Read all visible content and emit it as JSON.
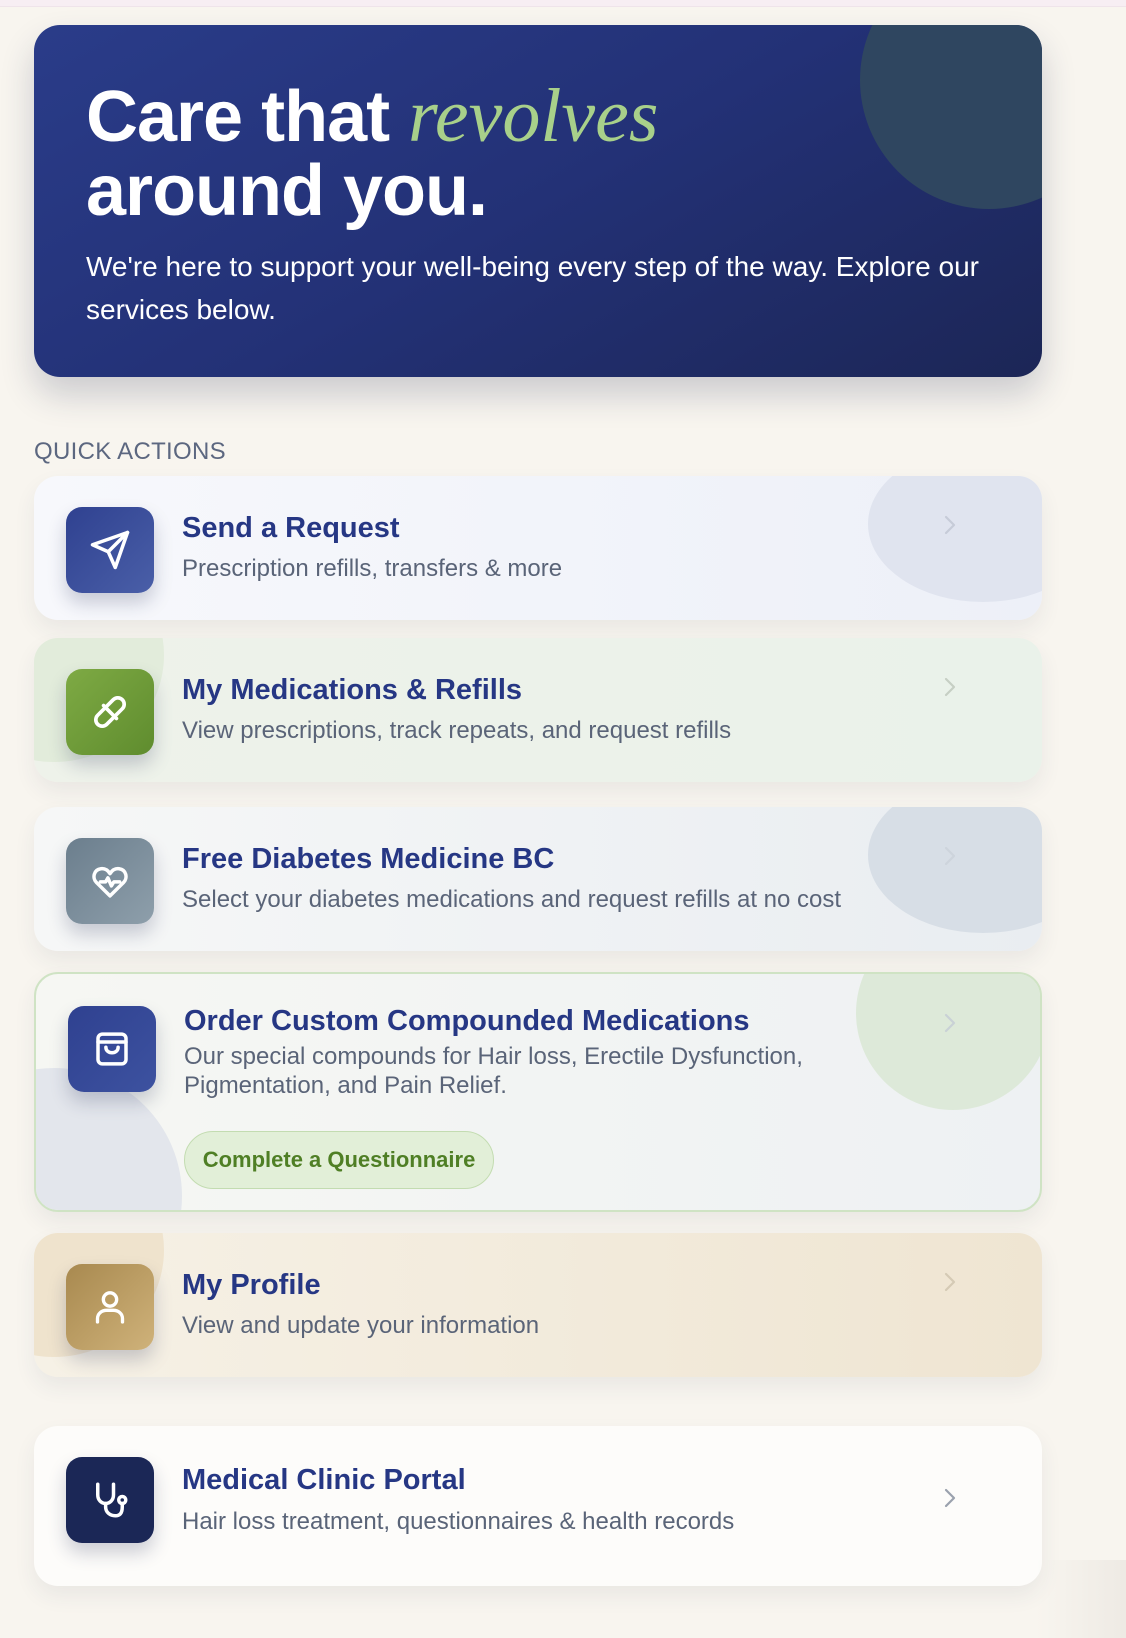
{
  "hero": {
    "title_part1": "Care that ",
    "title_accent": "revolves",
    "title_line2": "around you.",
    "subtitle": "We're here to support your well-being every step of the way. Explore our services below."
  },
  "quick_actions": {
    "label": "QUICK ACTIONS",
    "cards": [
      {
        "title": "Send a Request",
        "description": "Prescription refills, transfers & more",
        "icon": "send-icon"
      },
      {
        "title": "My Medications & Refills",
        "description": "View prescriptions, track repeats, and request refills",
        "icon": "pill-icon"
      },
      {
        "title": "Free Diabetes Medicine BC",
        "description": "Select your diabetes medications and request refills at no cost",
        "icon": "heart-pulse-icon"
      },
      {
        "title": "Order Custom Compounded Medications",
        "description": "Our special compounds for Hair loss, Erectile Dysfunction, Pigmentation, and Pain Relief.",
        "icon": "shopping-bag-icon",
        "button_label": "Complete a Questionnaire"
      },
      {
        "title": "My Profile",
        "description": "View and update your information",
        "icon": "user-icon"
      },
      {
        "title": "Medical Clinic Portal",
        "description": "Hair loss treatment, questionnaires & health records",
        "icon": "stethoscope-icon"
      }
    ]
  },
  "colors": {
    "hero_bg": "#263580",
    "accent_green": "#a8d08a",
    "title_navy": "#263784",
    "page_bg": "#f8f5ef"
  }
}
